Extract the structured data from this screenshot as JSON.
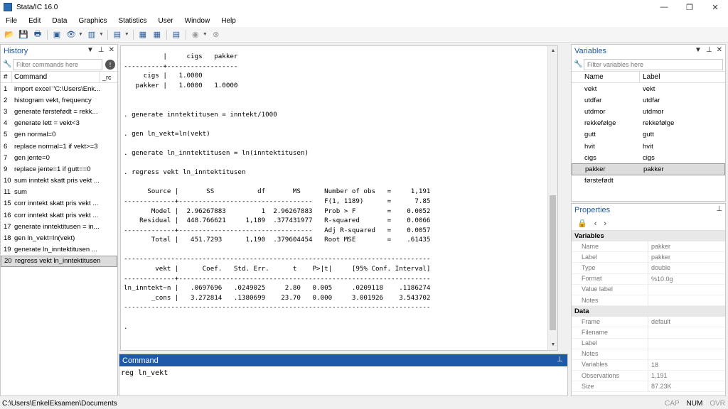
{
  "window": {
    "title": "Stata/IC 16.0",
    "min": "—",
    "max": "❐",
    "close": "✕"
  },
  "menu": [
    "File",
    "Edit",
    "Data",
    "Graphics",
    "Statistics",
    "User",
    "Window",
    "Help"
  ],
  "history": {
    "title": "History",
    "filter_placeholder": "Filter commands here",
    "col_num": "#",
    "col_cmd": "Command",
    "col_rc": "_rc",
    "items": [
      {
        "n": "1",
        "cmd": "import excel \"C:\\Users\\Enk..."
      },
      {
        "n": "2",
        "cmd": "histogram vekt, frequency"
      },
      {
        "n": "3",
        "cmd": "generate førstefødt = rekk..."
      },
      {
        "n": "4",
        "cmd": "generate lett = vekt<3"
      },
      {
        "n": "5",
        "cmd": "gen normal=0"
      },
      {
        "n": "6",
        "cmd": "replace normal=1 if vekt>=3"
      },
      {
        "n": "7",
        "cmd": "gen jente=0"
      },
      {
        "n": "9",
        "cmd": "replace jente=1 if gutt==0"
      },
      {
        "n": "10",
        "cmd": "sum inntekt skatt pris vekt ..."
      },
      {
        "n": "11",
        "cmd": "sum"
      },
      {
        "n": "15",
        "cmd": "corr inntekt skatt pris vekt ..."
      },
      {
        "n": "16",
        "cmd": "corr inntekt skatt pris vekt ..."
      },
      {
        "n": "17",
        "cmd": "generate inntektitusen = in..."
      },
      {
        "n": "18",
        "cmd": "gen ln_vekt=ln(vekt)"
      },
      {
        "n": "19",
        "cmd": "generate ln_inntektitusen ..."
      },
      {
        "n": "20",
        "cmd": "regress vekt ln_inntektitusen"
      }
    ]
  },
  "results": {
    "text": "          |     cigs   pakker\n----------+------------------\n     cigs |   1.0000\n   pakker |   1.0000   1.0000\n\n\n. generate inntektitusen = inntekt/1000\n\n. gen ln_vekt=ln(vekt)\n\n. generate ln_inntektitusen = ln(inntektitusen)\n\n. regress vekt ln_inntektitusen\n\n      Source |       SS           df       MS      Number of obs   =     1,191\n-------------+----------------------------------   F(1, 1189)      =      7.85\n       Model |  2.96267883         1  2.96267883   Prob > F        =    0.0052\n    Residual |  448.766621     1,189  .377431977   R-squared       =    0.0066\n-------------+----------------------------------   Adj R-squared   =    0.0057\n       Total |   451.7293      1,190  .379604454   Root MSE        =    .61435\n\n------------------------------------------------------------------------------\n        vekt |      Coef.   Std. Err.      t    P>|t|     [95% Conf. Interval]\n-------------+----------------------------------------------------------------\nln_inntekt~n |   .0697696   .0249025     2.80   0.005     .0209118    .1186274\n       _cons |   3.272814   .1380699    23.70   0.000     3.001926    3.543702\n------------------------------------------------------------------------------\n\n."
  },
  "command": {
    "title": "Command",
    "input": "reg ln_vekt "
  },
  "variables": {
    "title": "Variables",
    "filter_placeholder": "Filter variables here",
    "col_name": "Name",
    "col_label": "Label",
    "items": [
      {
        "name": "vekt",
        "label": "vekt"
      },
      {
        "name": "utdfar",
        "label": "utdfar"
      },
      {
        "name": "utdmor",
        "label": "utdmor"
      },
      {
        "name": "rekkefølge",
        "label": "rekkefølge"
      },
      {
        "name": "gutt",
        "label": "gutt"
      },
      {
        "name": "hvit",
        "label": "hvit"
      },
      {
        "name": "cigs",
        "label": "cigs"
      },
      {
        "name": "pakker",
        "label": "pakker"
      },
      {
        "name": "førstefødt",
        "label": ""
      }
    ]
  },
  "properties": {
    "title": "Properties",
    "groups": [
      {
        "name": "Variables",
        "rows": [
          {
            "k": "Name",
            "v": "pakker"
          },
          {
            "k": "Label",
            "v": "pakker"
          },
          {
            "k": "Type",
            "v": "double"
          },
          {
            "k": "Format",
            "v": "%10.0g"
          },
          {
            "k": "Value label",
            "v": ""
          },
          {
            "k": "Notes",
            "v": ""
          }
        ]
      },
      {
        "name": "Data",
        "rows": [
          {
            "k": "Frame",
            "v": "default"
          },
          {
            "k": "Filename",
            "v": ""
          },
          {
            "k": "Label",
            "v": ""
          },
          {
            "k": "Notes",
            "v": ""
          },
          {
            "k": "Variables",
            "v": "18"
          },
          {
            "k": "Observations",
            "v": "1,191"
          },
          {
            "k": "Size",
            "v": "87.23K"
          }
        ]
      }
    ]
  },
  "status": {
    "path": "C:\\Users\\EnkelEksamen\\Documents",
    "cap": "CAP",
    "num": "NUM",
    "ovr": "OVR"
  }
}
